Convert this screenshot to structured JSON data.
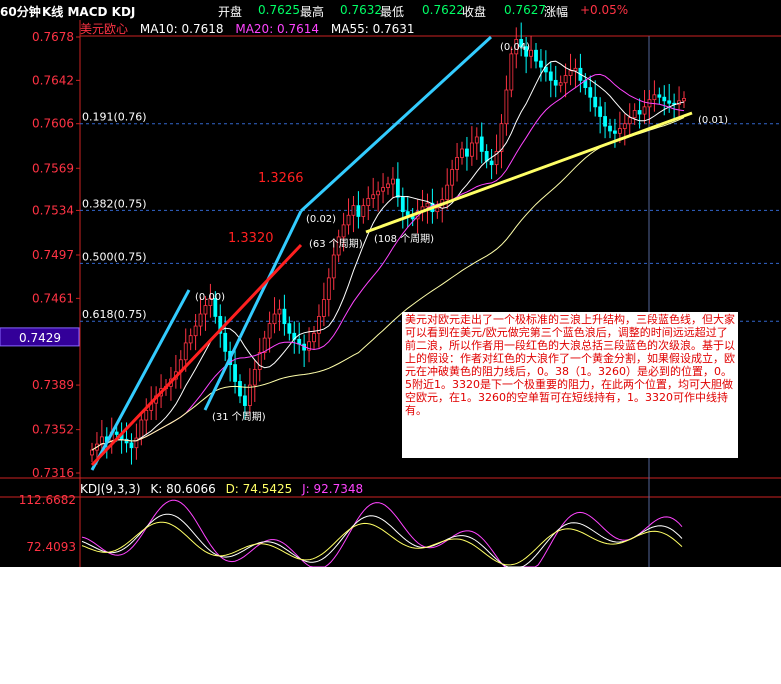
{
  "header": {
    "period": "60分钟",
    "indicators": "K线 MACD KDJ",
    "open_label": "开盘",
    "open_value": "0.7625",
    "high_label": "最高",
    "high_value": "0.7632",
    "low_label": "最低",
    "low_value": "0.7622",
    "close_label": "收盘",
    "close_value": "0.7627",
    "change_label": "涨幅",
    "change_value": "+0.05%"
  },
  "legend": {
    "symbol": "美元欧心",
    "ma10": "MA10: 0.7618",
    "ma20": "MA20: 0.7614",
    "ma55": "MA55: 0.7631",
    "kdj_name": "KDJ(9,3,3)",
    "kdj_k": "K: 80.6066",
    "kdj_d": "D: 74.5425",
    "kdj_j": "J: 92.7348"
  },
  "note": {
    "text": "美元对欧元走出了一个极标准的三浪上升结构，三段蓝色线，但大家可以看到在美元/欧元做完第三个蓝色浪后，调整的时间远远超过了前二浪，所以作者用一段红色的大浪总括三段蓝色的次级浪。基于以上的假设：作者对红色的大浪作了一个黄金分割，如果假设成立，欧元在冲破黄色的阻力线后，0。38（1。3260）是必到的位置，0。5附近1。3320是下一个极重要的阻力，在此两个位置，均可大胆做空欧元，在1。3260的空单暂可在短线持有，1。3320可作中线持有。"
  },
  "colors": {
    "background": "#000000",
    "up_candle": "#ff3344",
    "down_candle": "#00ffff",
    "ma10": "#ffffff",
    "ma20": "#ff44ff",
    "ma55": "#ffffaa",
    "wave_blue": "#33ccff",
    "wave_red": "#ff2020",
    "support_yellow": "#ffff66",
    "fib_line": "#3366cc",
    "current_price_box": "#330099"
  },
  "chart_data": [
    {
      "type": "candlestick",
      "y_ticks": [
        "0.7678",
        "0.7642",
        "0.7606",
        "0.7569",
        "0.7534",
        "0.7497",
        "0.7461",
        "0.7425",
        "0.7389",
        "0.7352",
        "0.7316"
      ],
      "ylim": [
        0.7316,
        0.7678
      ],
      "current_price": "0.7429",
      "fib_levels": [
        {
          "label": "0.191(0.76)",
          "value": 0.7606
        },
        {
          "label": "0.382(0.75)",
          "value": 0.7534
        },
        {
          "label": "0.500(0.75)",
          "value": 0.749
        },
        {
          "label": "0.618(0.75)",
          "value": 0.7442
        }
      ],
      "annotations": [
        {
          "text": "1.3266",
          "near_value": 0.756
        },
        {
          "text": "1.3320",
          "near_value": 0.751
        },
        {
          "text": "(0.04)",
          "near_value": 0.7677
        },
        {
          "text": "(0.02)",
          "near_value": 0.7531
        },
        {
          "text": "(0.00)",
          "near_value": 0.7464
        },
        {
          "text": "(0.01)",
          "near_value": 0.7608
        },
        {
          "text": "(63 个周期)",
          "near_value": 0.7505
        },
        {
          "text": "(108 个周期)",
          "near_value": 0.7508
        },
        {
          "text": "(31 个周期)",
          "near_value": 0.7366
        }
      ],
      "series": [
        {
          "name": "MA10",
          "value": 0.7618
        },
        {
          "name": "MA20",
          "value": 0.7614
        },
        {
          "name": "MA55",
          "value": 0.7631
        }
      ],
      "candles_close": [
        0.7335,
        0.734,
        0.7346,
        0.7342,
        0.735,
        0.7348,
        0.7344,
        0.7341,
        0.7337,
        0.7345,
        0.736,
        0.7368,
        0.7374,
        0.738,
        0.7386,
        0.7388,
        0.7394,
        0.74,
        0.741,
        0.7424,
        0.743,
        0.7438,
        0.7448,
        0.7455,
        0.7461,
        0.7446,
        0.7432,
        0.7417,
        0.7406,
        0.7392,
        0.738,
        0.7372,
        0.7389,
        0.7402,
        0.7416,
        0.7428,
        0.744,
        0.7448,
        0.7452,
        0.744,
        0.7432,
        0.7427,
        0.7423,
        0.7418,
        0.7425,
        0.7432,
        0.7446,
        0.746,
        0.7478,
        0.7497,
        0.7512,
        0.7522,
        0.753,
        0.7538,
        0.7529,
        0.7538,
        0.7544,
        0.7547,
        0.755,
        0.7553,
        0.7556,
        0.756,
        0.7545,
        0.7533,
        0.753,
        0.7527,
        0.7533,
        0.7537,
        0.754,
        0.7533,
        0.7536,
        0.7543,
        0.7555,
        0.7568,
        0.7578,
        0.7585,
        0.7579,
        0.759,
        0.7595,
        0.7583,
        0.7575,
        0.7572,
        0.7583,
        0.7606,
        0.7634,
        0.7664,
        0.7676,
        0.767,
        0.7662,
        0.7667,
        0.7658,
        0.7653,
        0.7649,
        0.7642,
        0.7638,
        0.764,
        0.7646,
        0.765,
        0.7652,
        0.7642,
        0.7636,
        0.7628,
        0.762,
        0.7612,
        0.7604,
        0.76,
        0.7598,
        0.7602,
        0.7606,
        0.7611,
        0.7617,
        0.7614,
        0.762,
        0.7626,
        0.763,
        0.7628,
        0.7625,
        0.7623,
        0.7622,
        0.7625,
        0.7627
      ]
    },
    {
      "type": "line",
      "title": "KDJ(9,3,3)",
      "y_ticks": [
        "112.6682",
        "72.4093"
      ]
    }
  ]
}
